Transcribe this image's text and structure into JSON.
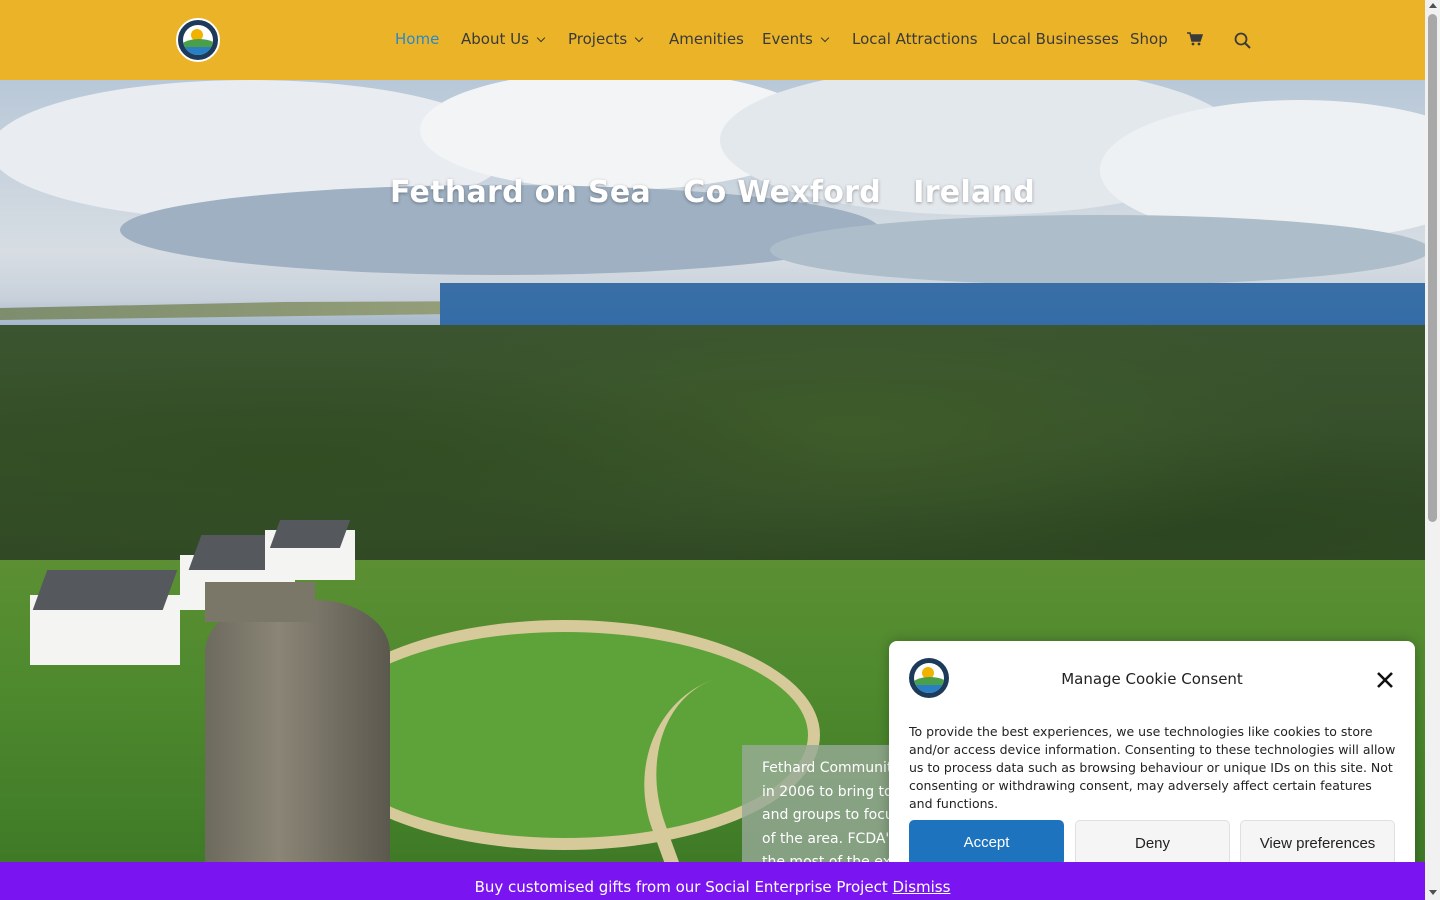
{
  "nav": {
    "items": [
      {
        "label": "Home",
        "has_dropdown": false,
        "active": true
      },
      {
        "label": "About Us",
        "has_dropdown": true,
        "active": false
      },
      {
        "label": "Projects",
        "has_dropdown": true,
        "active": false
      },
      {
        "label": "Amenities",
        "has_dropdown": false,
        "active": false
      },
      {
        "label": "Events",
        "has_dropdown": true,
        "active": false
      },
      {
        "label": "Local Attractions",
        "has_dropdown": false,
        "active": false
      },
      {
        "label": "Local Businesses",
        "has_dropdown": false,
        "active": false
      },
      {
        "label": "Shop",
        "has_dropdown": false,
        "active": false
      }
    ],
    "cart_icon": "cart-icon",
    "search_icon": "search-icon"
  },
  "hero": {
    "title": "Fethard on Sea   Co Wexford   Ireland",
    "intro_lines": [
      "Fethard Community",
      "in 2006 to bring to",
      "and groups to focu",
      "of the area. FCDA's",
      "the most of the ex"
    ]
  },
  "notice": {
    "text": "Buy customised gifts from our Social Enterprise Project",
    "dismiss": "Dismiss"
  },
  "cookie": {
    "title": "Manage Cookie Consent",
    "body": "To provide the best experiences, we use technologies like cookies to store and/or access device information. Consenting to these technologies will allow us to process data such as browsing behaviour or unique IDs on this site. Not consenting or withdrawing consent, may adversely affect certain features and functions.",
    "accept": "Accept",
    "deny": "Deny",
    "preferences": "View preferences"
  },
  "colors": {
    "header_bg": "#ebb428",
    "nav_active": "#2b87c8",
    "notice_bg": "#7a14f0",
    "accept_bg": "#1e73be"
  }
}
